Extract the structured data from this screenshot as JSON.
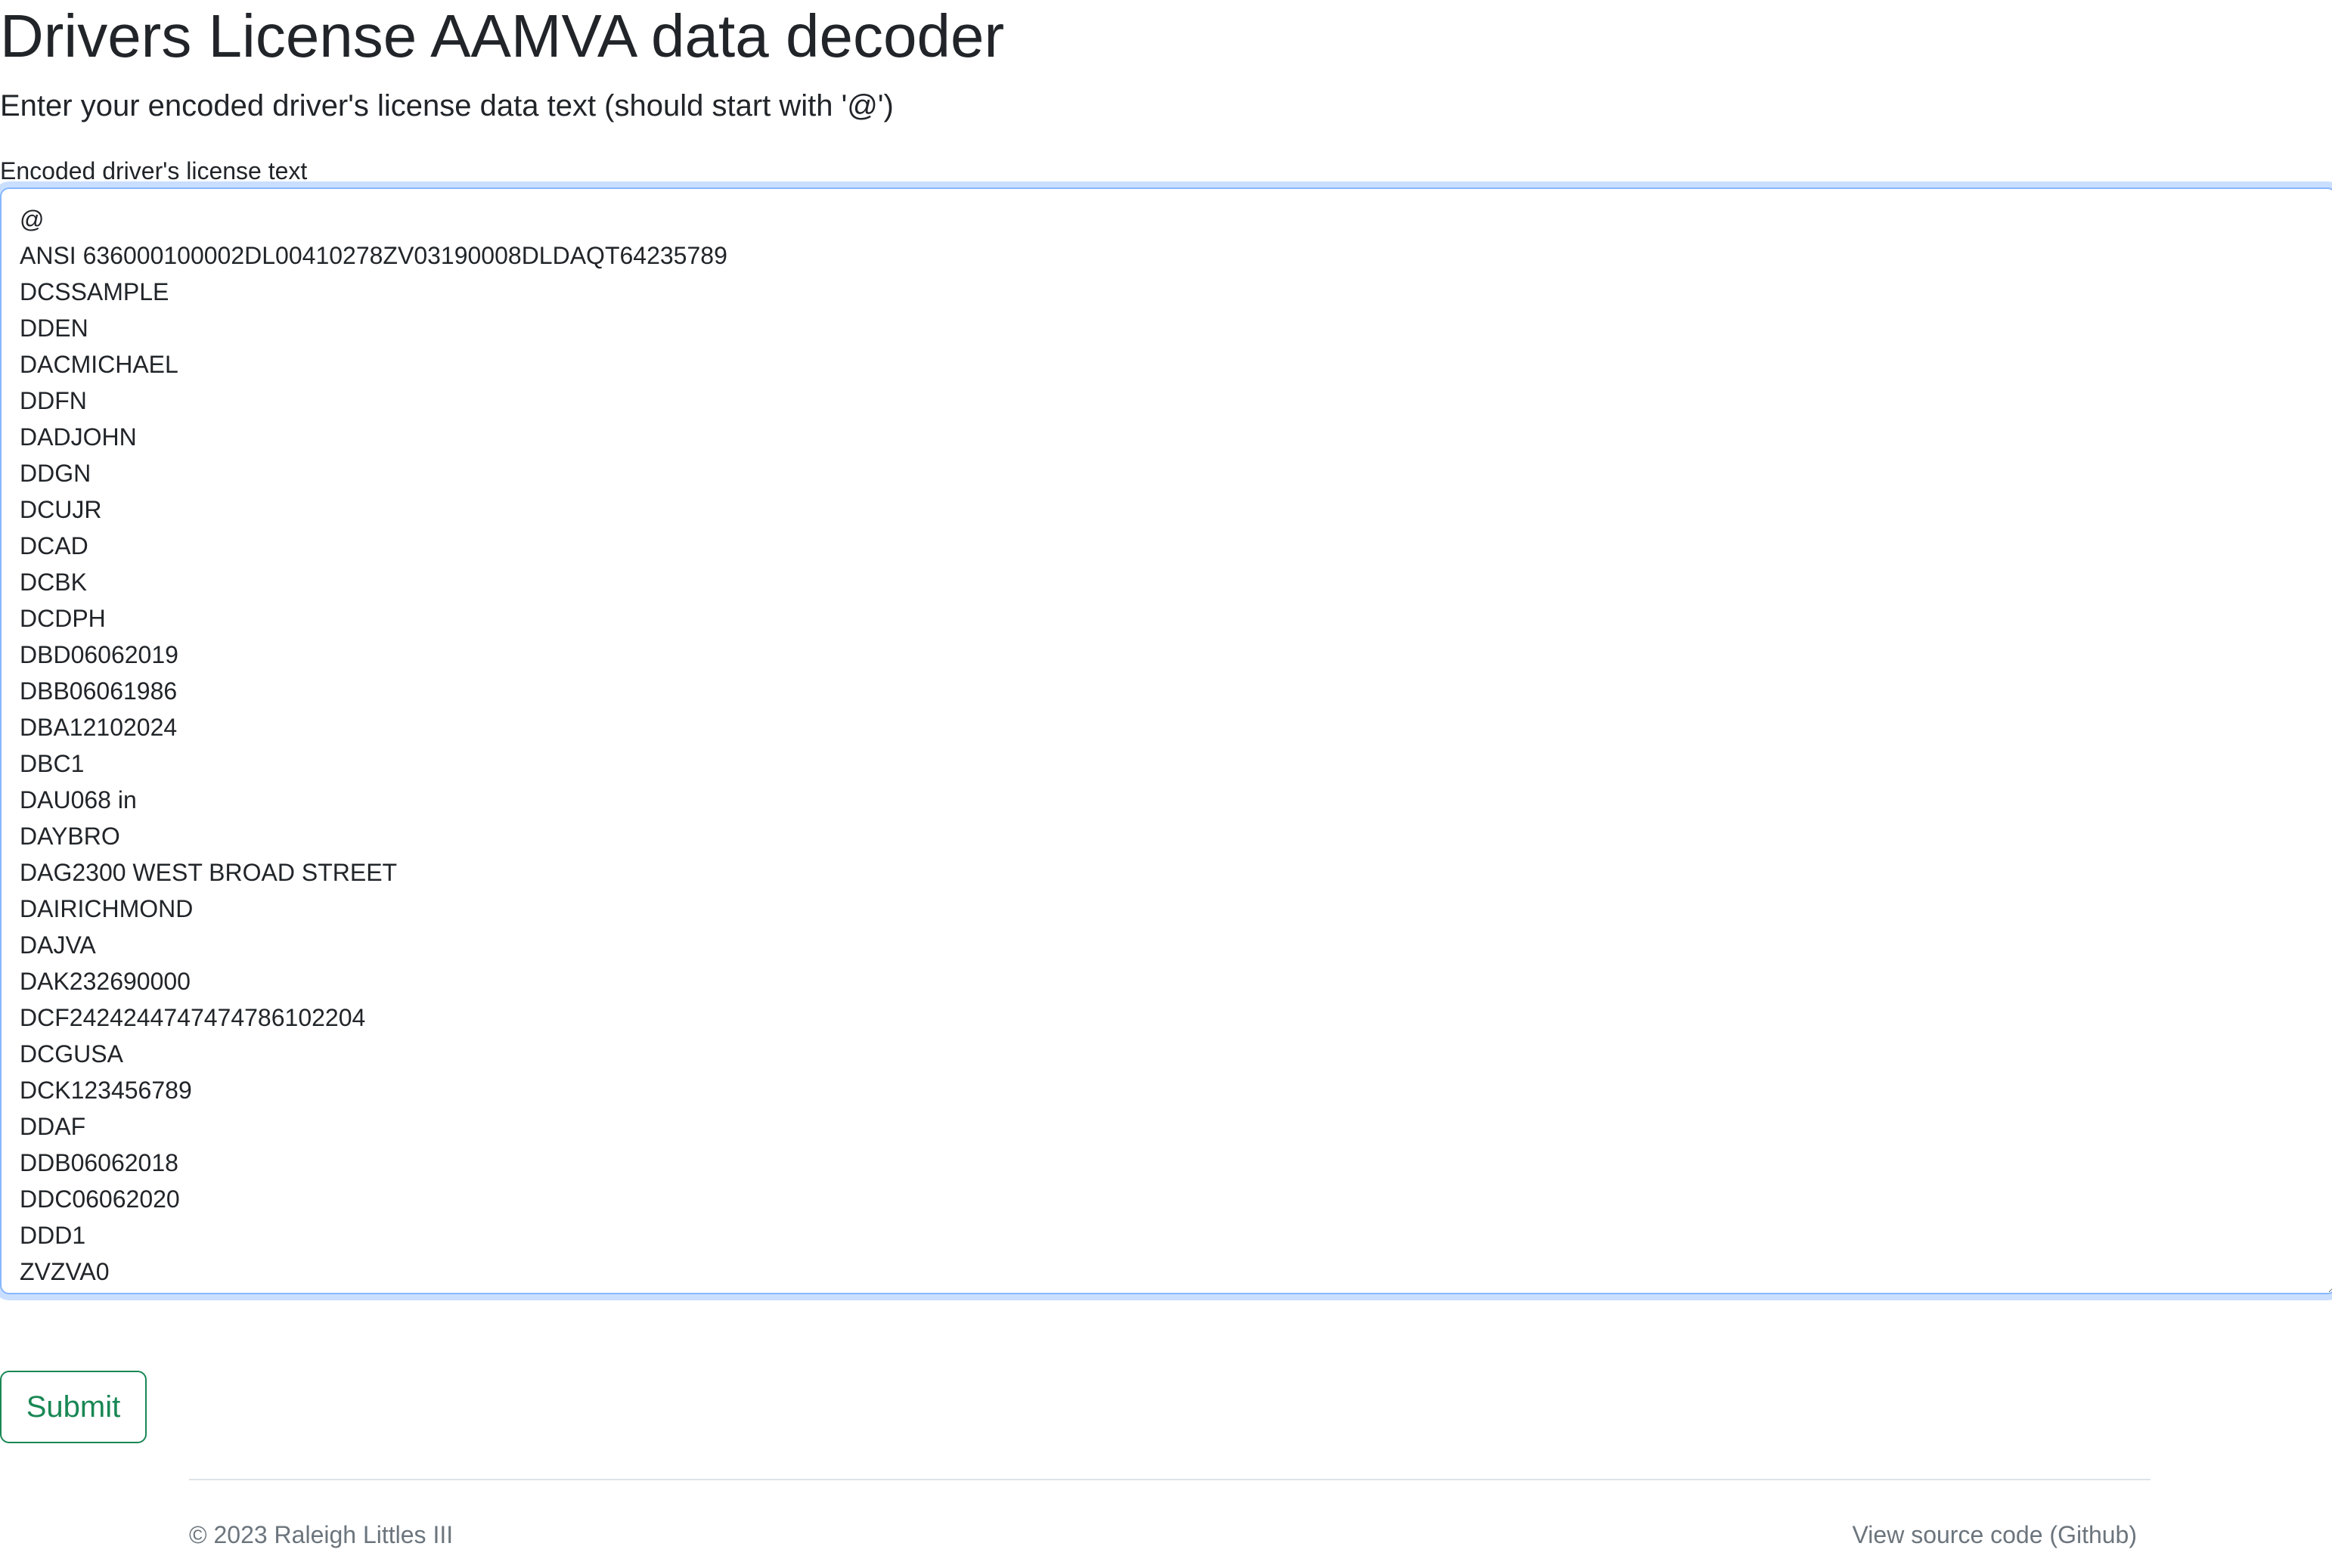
{
  "page": {
    "title": "Drivers License AAMVA data decoder",
    "subtitle": "Enter your encoded driver's license data text (should start with '@')"
  },
  "form": {
    "label": "Encoded driver's license text",
    "textarea_value": "@\nANSI 636000100002DL00410278ZV03190008DLDAQT64235789\nDCSSAMPLE\nDDEN\nDACMICHAEL\nDDFN\nDADJOHN\nDDGN\nDCUJR\nDCAD\nDCBK\nDCDPH\nDBD06062019\nDBB06061986\nDBA12102024\nDBC1\nDAU068 in\nDAYBRO\nDAG2300 WEST BROAD STREET\nDAIRICHMOND\nDAJVA\nDAK232690000\nDCF2424244747474786102204\nDCGUSA\nDCK123456789\nDDAF\nDDB06062018\nDDC06062020\nDDD1\nZVZVA0",
    "submit_label": "Submit"
  },
  "footer": {
    "copyright": "© 2023 Raleigh Littles III",
    "source_link": "View source code (Github)"
  },
  "colors": {
    "text": "#212529",
    "success": "#198754",
    "focus_border": "#86b7fe",
    "muted": "#6c757d",
    "divider": "#dee2e6"
  }
}
